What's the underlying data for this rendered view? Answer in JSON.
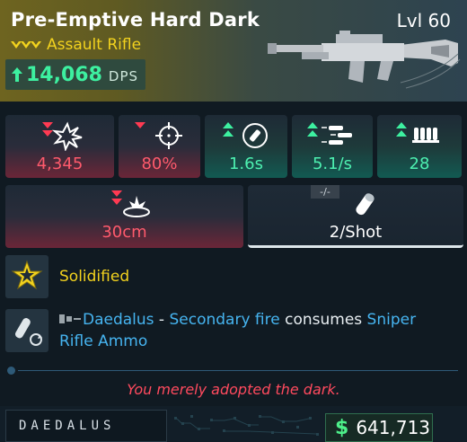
{
  "item": {
    "name": "Pre-Emptive Hard Dark",
    "level": "Lvl 60",
    "type": "Assault Rifle",
    "dps_value": "14,068",
    "dps_unit": "DPS"
  },
  "stats": [
    {
      "id": "damage",
      "value": "4,345",
      "trend": "down",
      "icon": "burst-icon"
    },
    {
      "id": "accuracy",
      "value": "80%",
      "trend": "down",
      "icon": "crosshair-icon"
    },
    {
      "id": "reload",
      "value": "1.6s",
      "trend": "up",
      "icon": "reload-timer-icon"
    },
    {
      "id": "fire_rate",
      "value": "5.1/s",
      "trend": "up",
      "icon": "bullets-icon"
    },
    {
      "id": "magazine",
      "value": "28",
      "trend": "up",
      "icon": "magazine-icon"
    }
  ],
  "wide_stats": {
    "splash": {
      "value": "30cm",
      "trend": "down",
      "icon": "splash-icon"
    },
    "ammo": {
      "value": "2/Shot",
      "tag": "-/-",
      "icon": "ammo-cost-icon"
    }
  },
  "perks": {
    "perk1": {
      "name": "Solidified"
    },
    "perk2": {
      "manufacturer": "Daedalus",
      "sep": " - ",
      "part1": "Secondary fire",
      "part2": " consumes ",
      "part3": "Sniper",
      "part4": "Rifle Ammo"
    }
  },
  "flavor_text": "You merely adopted the dark.",
  "footer": {
    "brand": "DAEDALUS",
    "currency_symbol": "$",
    "price": "641,713"
  },
  "colors": {
    "negative": "#ff5a6c",
    "positive": "#4df0b0",
    "rarity": "#f2d21e",
    "highlight": "#46b4f0"
  }
}
